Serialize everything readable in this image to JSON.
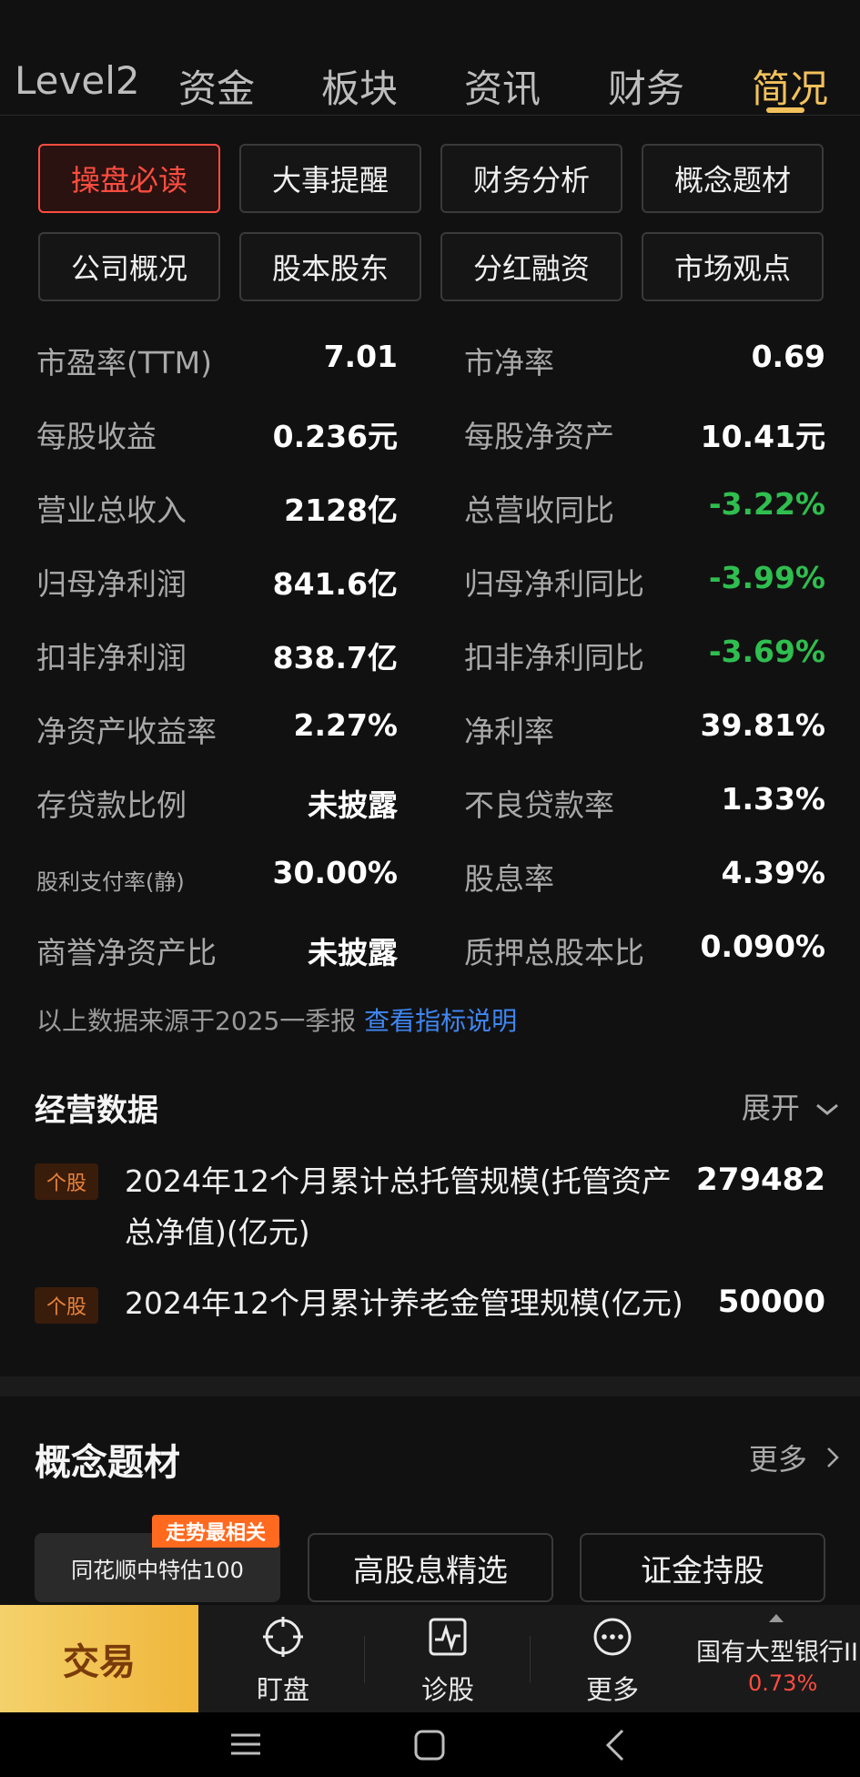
{
  "tabs": [
    "Level2",
    "资金",
    "板块",
    "资讯",
    "财务",
    "简况"
  ],
  "sub_buttons": [
    "操盘必读",
    "大事提醒",
    "财务分析",
    "概念题材",
    "公司概况",
    "股本股东",
    "分红融资",
    "市场观点"
  ],
  "metrics": [
    {
      "label": "市盈率(TTM)",
      "value": "7.01"
    },
    {
      "label": "市净率",
      "value": "0.69"
    },
    {
      "label": "每股收益",
      "value": "0.236元"
    },
    {
      "label": "每股净资产",
      "value": "10.41元"
    },
    {
      "label": "营业总收入",
      "value": "2128亿"
    },
    {
      "label": "总营收同比",
      "value": "-3.22%"
    },
    {
      "label": "归母净利润",
      "value": "841.6亿"
    },
    {
      "label": "归母净利同比",
      "value": "-3.99%"
    },
    {
      "label": "扣非净利润",
      "value": "838.7亿"
    },
    {
      "label": "扣非净利同比",
      "value": "-3.69%"
    },
    {
      "label": "净资产收益率",
      "value": "2.27%"
    },
    {
      "label": "净利率",
      "value": "39.81%"
    },
    {
      "label": "存贷款比例",
      "value": "未披露"
    },
    {
      "label": "不良贷款率",
      "value": "1.33%"
    },
    {
      "label": "股利支付率(静)",
      "value": "30.00%"
    },
    {
      "label": "股息率",
      "value": "4.39%"
    },
    {
      "label": "商誉净资产比",
      "value": "未披露"
    },
    {
      "label": "质押总股本比",
      "value": "0.090%"
    }
  ],
  "note": {
    "text": "以上数据来源于2025一季报",
    "link": "查看指标说明"
  },
  "business": {
    "title": "经营数据",
    "expand": "展开",
    "rows": [
      {
        "tag": "个股",
        "text": "2024年12个月累计总托管规模(托管资产总净值)(亿元)",
        "value": "279482"
      },
      {
        "tag": "个股",
        "text": "2024年12个月累计养老金管理规模(亿元)",
        "value": "50000"
      }
    ]
  },
  "concept": {
    "title": "概念题材",
    "more": "更多",
    "badge": "走势最相关",
    "chips": [
      "同花顺中特估100",
      "高股息精选",
      "证金持股"
    ]
  },
  "bottom": {
    "trade": "交易",
    "nav": [
      "盯盘",
      "诊股",
      "更多"
    ],
    "sector": "国有大型银行II",
    "sector_change": "0.73%"
  },
  "colors": {
    "accent": "#f2c15b",
    "up": "#ff4d3f",
    "down": "#2fbe4f",
    "link": "#3f86f2"
  }
}
